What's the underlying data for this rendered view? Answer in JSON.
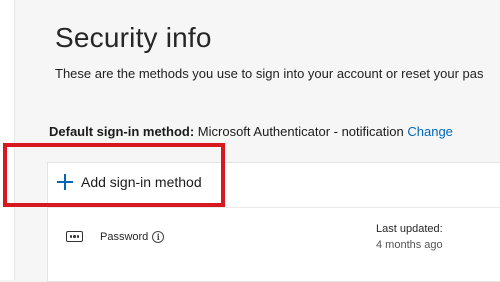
{
  "page": {
    "title": "Security info",
    "subtitle": "These are the methods you use to sign into your account or reset your pas"
  },
  "default_method": {
    "label": "Default sign-in method:",
    "value": "Microsoft Authenticator - notification",
    "change_link": "Change"
  },
  "card": {
    "add_button_label": "Add sign-in method",
    "add_icon": "plus-icon",
    "methods": [
      {
        "icon": "password-dots-icon",
        "name": "Password",
        "updated_label": "Last updated:",
        "updated_value": "4 months ago"
      }
    ]
  },
  "colors": {
    "accent": "#0067b8",
    "highlight": "#d6191f"
  }
}
